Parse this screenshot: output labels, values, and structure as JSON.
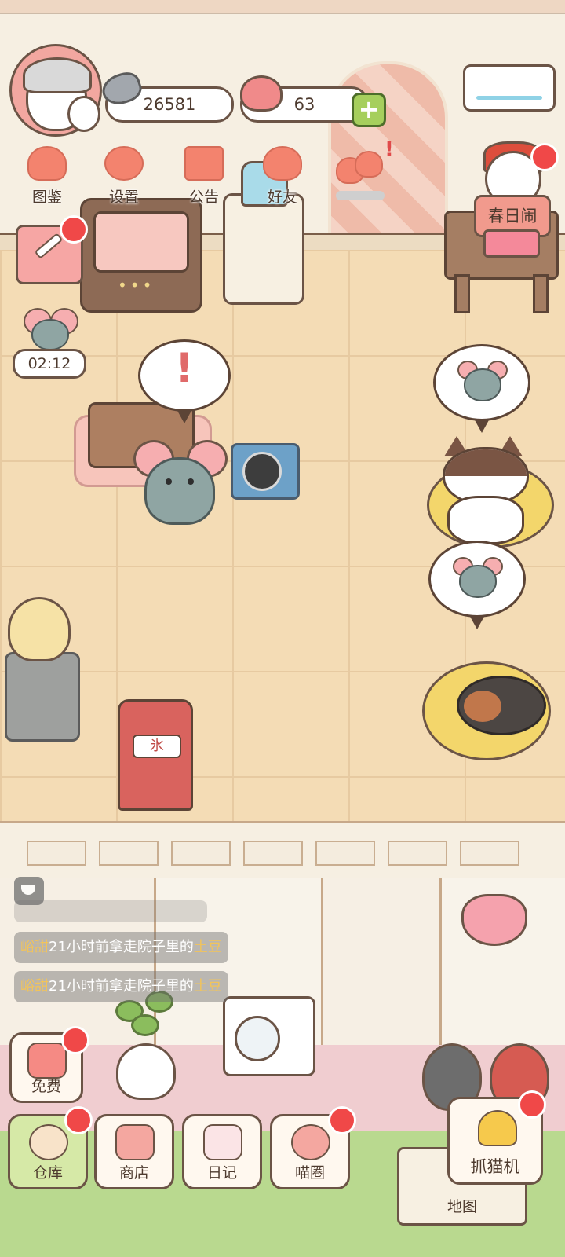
{
  "hud": {
    "coins": "26581",
    "hearts": "63",
    "hearts_plus": "+",
    "love_progress": 0.0
  },
  "top_menu": {
    "handbook": "图鉴",
    "settings": "设置",
    "announcement": "公告",
    "friends": "好友",
    "alert_mark": "!"
  },
  "event": {
    "label": "春日闹"
  },
  "timer": {
    "value": "02:12"
  },
  "scene": {
    "alert_mark": "!",
    "ice_machine_label": "氷"
  },
  "chat": {
    "lines": [
      {
        "name": "峪甜",
        "text": "21小时前拿走院子里的",
        "item": "土豆"
      },
      {
        "name": "峪甜",
        "text": "21小时前拿走院子里的",
        "item": "土豆"
      }
    ]
  },
  "bottom_nav": {
    "free": "免费",
    "warehouse": "仓库",
    "shop": "商店",
    "diary": "日记",
    "cat_circle": "喵圈",
    "claw_machine": "抓猫机",
    "map": "地图"
  },
  "colors": {
    "accent": "#f3836e",
    "notification": "#f04848",
    "floor": "#f4dcb5",
    "highlight_item": "#f2c45a"
  },
  "icons": {
    "coin": "fish-icon",
    "hearts": "heart-face-icon",
    "handbook": "cat-head-icon",
    "settings": "gear-icon",
    "announcement": "gift-icon",
    "friends": "friends-icon",
    "love": "hearts-icon",
    "diary_shortcut": "pencil-icon"
  }
}
